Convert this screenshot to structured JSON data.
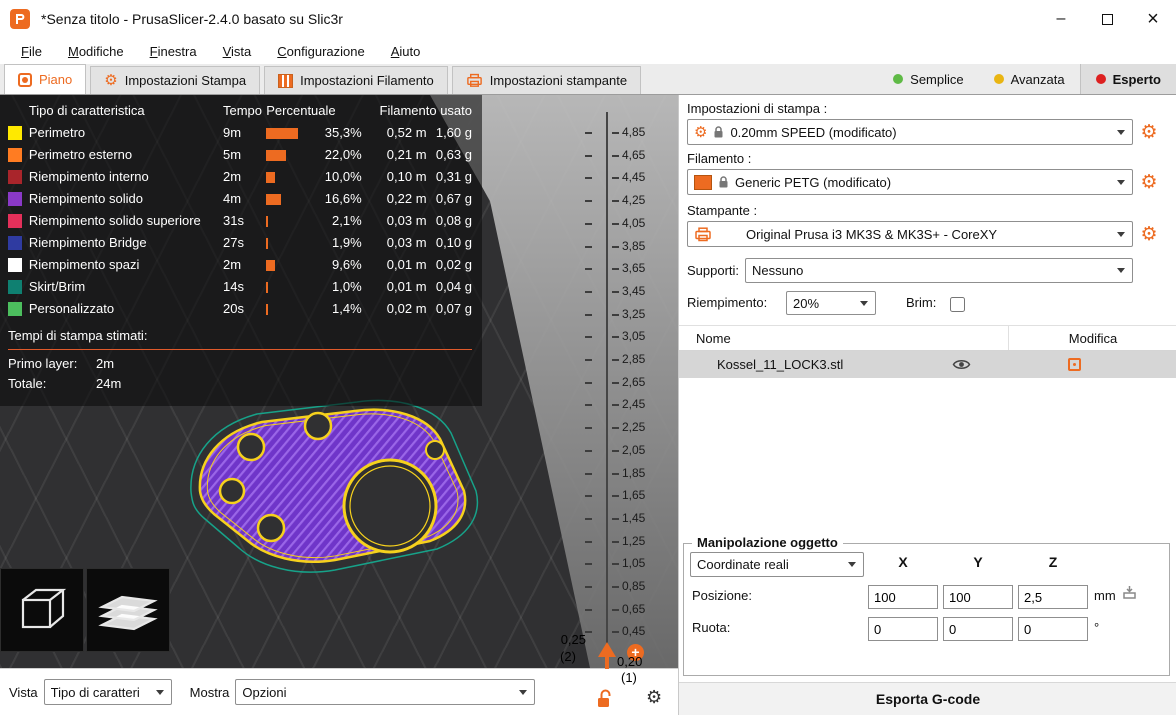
{
  "window": {
    "title": "*Senza titolo - PrusaSlicer-2.4.0 basato su Slic3r",
    "controls": {
      "minimize": "–",
      "close": "×"
    }
  },
  "menu": {
    "items": [
      "File",
      "Modifiche",
      "Finestra",
      "Vista",
      "Configurazione",
      "Aiuto"
    ]
  },
  "tabs": {
    "items": [
      {
        "label": "Piano"
      },
      {
        "label": "Impostazioni Stampa"
      },
      {
        "label": "Impostazioni Filamento"
      },
      {
        "label": "Impostazioni stampante"
      }
    ],
    "modes": [
      {
        "label": "Semplice",
        "color": "#5fba46"
      },
      {
        "label": "Avanzata",
        "color": "#e9b512"
      },
      {
        "label": "Esperto",
        "color": "#dd2020"
      }
    ]
  },
  "legend": {
    "headers": [
      "Tipo di caratteristica",
      "Tempo",
      "Percentuale",
      "Filamento usato"
    ],
    "rows": [
      {
        "name": "Perimetro",
        "color": "#ffe900",
        "time": "9m",
        "pct": "35,3%",
        "pct_value": 35.3,
        "m": "0,52 m",
        "g": "1,60 g"
      },
      {
        "name": "Perimetro esterno",
        "color": "#ff7c22",
        "time": "5m",
        "pct": "22,0%",
        "pct_value": 22.0,
        "m": "0,21 m",
        "g": "0,63 g"
      },
      {
        "name": "Riempimento interno",
        "color": "#a9252b",
        "time": "2m",
        "pct": "10,0%",
        "pct_value": 10.0,
        "m": "0,10 m",
        "g": "0,31 g"
      },
      {
        "name": "Riempimento solido",
        "color": "#8a39c7",
        "time": "4m",
        "pct": "16,6%",
        "pct_value": 16.6,
        "m": "0,22 m",
        "g": "0,67 g"
      },
      {
        "name": "Riempimento solido superiore",
        "color": "#e4305a",
        "time": "31s",
        "pct": "2,1%",
        "pct_value": 2.1,
        "m": "0,03 m",
        "g": "0,08 g"
      },
      {
        "name": "Riempimento Bridge",
        "color": "#2f3ba1",
        "time": "27s",
        "pct": "1,9%",
        "pct_value": 1.9,
        "m": "0,03 m",
        "g": "0,10 g"
      },
      {
        "name": "Riempimento spazi",
        "color": "#ffffff",
        "time": "2m",
        "pct": "9,6%",
        "pct_value": 9.6,
        "m": "0,01 m",
        "g": "0,02 g"
      },
      {
        "name": "Skirt/Brim",
        "color": "#0f8071",
        "time": "14s",
        "pct": "1,0%",
        "pct_value": 1.0,
        "m": "0,01 m",
        "g": "0,04 g"
      },
      {
        "name": "Personalizzato",
        "color": "#4cbe5e",
        "time": "20s",
        "pct": "1,4%",
        "pct_value": 1.4,
        "m": "0,02 m",
        "g": "0,07 g"
      }
    ],
    "estimates_title": "Tempi di stampa stimati:",
    "first_layer_label": "Primo layer:",
    "first_layer_value": "2m",
    "total_label": "Totale:",
    "total_value": "24m"
  },
  "viewport": {
    "slider": {
      "ticks": [
        "4,85",
        "4,65",
        "4,45",
        "4,25",
        "4,05",
        "3,85",
        "3,65",
        "3,45",
        "3,25",
        "3,05",
        "2,85",
        "2,65",
        "2,45",
        "2,25",
        "2,05",
        "1,85",
        "1,65",
        "1,45",
        "1,25",
        "1,05",
        "0,85",
        "0,65",
        "0,45"
      ],
      "upper_value": "0,25",
      "upper_index": "(2)",
      "lower_value": "0,20",
      "lower_index": "(1)",
      "plus_glyph": "+"
    }
  },
  "sidebar": {
    "print_settings_label": "Impostazioni di stampa :",
    "print_settings_value": "0.20mm SPEED (modificato)",
    "filament_label": "Filamento :",
    "filament_value": "Generic PETG (modificato)",
    "printer_label": "Stampante :",
    "printer_value": "Original Prusa i3 MK3S & MK3S+ - CoreXY",
    "supports_label": "Supporti:",
    "supports_value": "Nessuno",
    "infill_label": "Riempimento:",
    "infill_value": "20%",
    "brim_label": "Brim:",
    "brim_checked": false,
    "table": {
      "name_header": "Nome",
      "modify_header": "Modifica",
      "rows": [
        {
          "name": "Kossel_11_LOCK3.stl"
        }
      ]
    },
    "manipulation": {
      "title": "Manipolazione oggetto",
      "coordinates_value": "Coordinate reali",
      "axes": [
        "X",
        "Y",
        "Z"
      ],
      "position_label": "Posizione:",
      "position": [
        "100",
        "100",
        "2,5"
      ],
      "position_unit": "mm",
      "rotate_label": "Ruota:",
      "rotate": [
        "0",
        "0",
        "0"
      ],
      "rotate_unit": "°"
    },
    "export_button": "Esporta G-code"
  },
  "bottom_bar": {
    "view_label": "Vista",
    "view_value": "Tipo di caratteri",
    "show_label": "Mostra",
    "show_value": "Opzioni"
  },
  "colors": {
    "accent": "#ed6b21"
  }
}
